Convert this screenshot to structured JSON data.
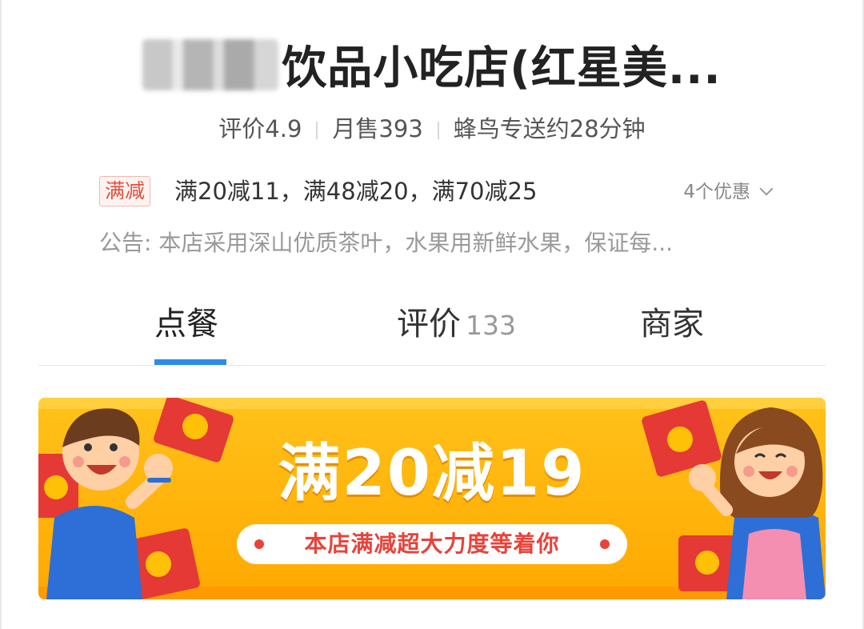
{
  "store": {
    "name_visible": "饮品小吃店(红星美...",
    "rating": "评价4.9",
    "monthly_sales": "月售393",
    "delivery": "蜂鸟专送约28分钟"
  },
  "promo": {
    "badge": "满减",
    "text": "满20减11，满48减20，满70减25",
    "more": "4个优惠"
  },
  "notice": "公告: 本店采用深山优质茶叶，水果用新鲜水果，保证每...",
  "tabs": [
    {
      "label": "点餐",
      "count": ""
    },
    {
      "label": "评价",
      "count": "133"
    },
    {
      "label": "商家",
      "count": ""
    }
  ],
  "active_tab": "点餐",
  "banner": {
    "headline": "满20减19",
    "subline": "本店满减超大力度等着你"
  },
  "colors": {
    "accent_blue": "#2e8bea",
    "badge_red": "#e0513f",
    "banner_orange": "#ffb300"
  }
}
